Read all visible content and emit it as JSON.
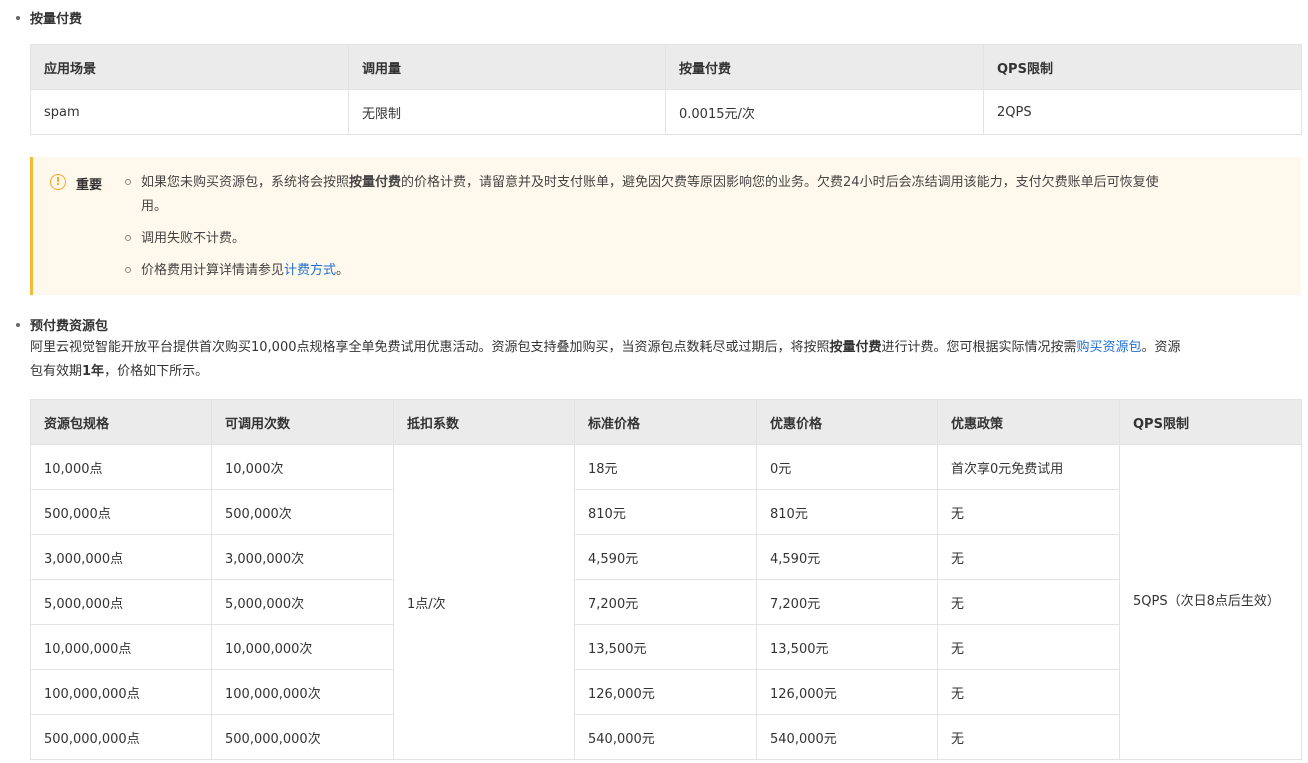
{
  "section1": {
    "title": "按量付费",
    "table": {
      "headers": [
        "应用场景",
        "调用量",
        "按量付费",
        "QPS限制"
      ],
      "rows": [
        [
          "spam",
          "无限制",
          "0.0015元/次",
          "2QPS"
        ]
      ]
    }
  },
  "notice": {
    "label": "重要",
    "icon": "warning-icon",
    "item1_a": "如果您未购买资源包，系统将会按照",
    "item1_b": "按量付费",
    "item1_c": "的价格计费，请留意并及时支付账单，避免因欠费等原因影响您的业务。欠费24小时后会冻结调用该能力，支付欠费账单后可恢复使",
    "item1_d": "用。",
    "item2": "调用失败不计费。",
    "item3_a": "价格费用计算详情请参见",
    "item3_link": "计费方式",
    "item3_b": "。"
  },
  "section2": {
    "title": "预付费资源包",
    "desc_a": "阿里云视觉智能开放平台提供首次购买10,000点规格享全单免费试用优惠活动。资源包支持叠加购买，当资源包点数耗尽或过期后，将按照",
    "desc_b": "按量付费",
    "desc_c": "进行计费。您可根据实际情况按需",
    "desc_link": "购买资源包",
    "desc_d": "。资源",
    "desc_e": "包有效期",
    "desc_f": "1年",
    "desc_g": "，价格如下所示。",
    "table": {
      "headers": [
        "资源包规格",
        "可调用次数",
        "抵扣系数",
        "标准价格",
        "优惠价格",
        "优惠政策",
        "QPS限制"
      ],
      "deduction": "1点/次",
      "qps": "5QPS（次日8点后生效）",
      "rows": [
        [
          "10,000点",
          "10,000次",
          "18元",
          "0元",
          "首次享0元免费试用"
        ],
        [
          "500,000点",
          "500,000次",
          "810元",
          "810元",
          "无"
        ],
        [
          "3,000,000点",
          "3,000,000次",
          "4,590元",
          "4,590元",
          "无"
        ],
        [
          "5,000,000点",
          "5,000,000次",
          "7,200元",
          "7,200元",
          "无"
        ],
        [
          "10,000,000点",
          "10,000,000次",
          "13,500元",
          "13,500元",
          "无"
        ],
        [
          "100,000,000点",
          "100,000,000次",
          "126,000元",
          "126,000元",
          "无"
        ],
        [
          "500,000,000点",
          "500,000,000次",
          "540,000元",
          "540,000元",
          "无"
        ]
      ]
    }
  }
}
